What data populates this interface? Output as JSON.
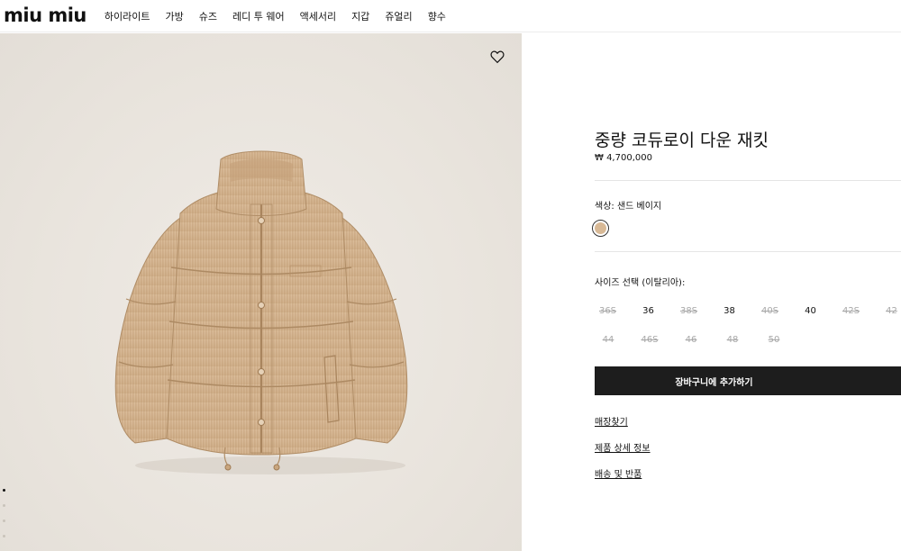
{
  "brand": {
    "logo": "miu miu"
  },
  "nav": {
    "items": [
      "하이라이트",
      "가방",
      "슈즈",
      "레디 투 웨어",
      "액세서리",
      "지갑",
      "쥬얼리",
      "향수"
    ]
  },
  "product": {
    "title": "중량 코듀로이 다운 재킷",
    "price": "₩ 4,700,000",
    "color_label": "색상: 샌드 베이지",
    "color_hex": "#d8b996",
    "size_label": "사이즈 선택 (이탈리아):",
    "sizes_row1": [
      {
        "label": "36S",
        "available": false
      },
      {
        "label": "36",
        "available": true
      },
      {
        "label": "38S",
        "available": false
      },
      {
        "label": "38",
        "available": true
      },
      {
        "label": "40S",
        "available": false
      },
      {
        "label": "40",
        "available": true
      },
      {
        "label": "42S",
        "available": false
      },
      {
        "label": "42",
        "available": false
      }
    ],
    "sizes_row2": [
      {
        "label": "44",
        "available": false
      },
      {
        "label": "46S",
        "available": false
      },
      {
        "label": "46",
        "available": false
      },
      {
        "label": "48",
        "available": false
      },
      {
        "label": "50",
        "available": false
      }
    ],
    "add_to_cart": "장바구니에 추가하기",
    "links": {
      "store": "매장찾기",
      "details": "제품 상세 정보",
      "shipping": "배송 및 반품"
    },
    "gallery_dots": {
      "total": 4,
      "active": 1
    }
  },
  "icons": {
    "wishlist": "heart-icon"
  }
}
